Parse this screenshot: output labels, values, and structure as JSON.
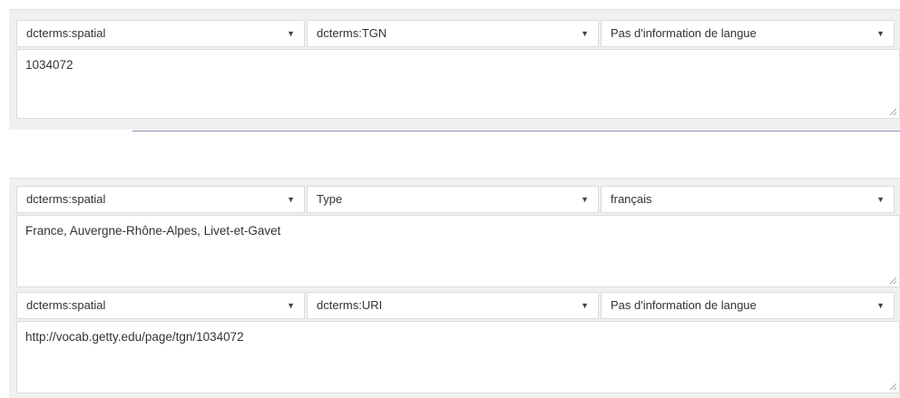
{
  "entries": [
    {
      "property": "dcterms:spatial",
      "type": "dcterms:TGN",
      "language": "Pas d'information de langue",
      "value": "1034072"
    },
    {
      "property": "dcterms:spatial",
      "type": "Type",
      "language": "français",
      "value": "France, Auvergne-Rhône-Alpes, Livet-et-Gavet"
    },
    {
      "property": "dcterms:spatial",
      "type": "dcterms:URI",
      "language": "Pas d'information de langue",
      "value": "http://vocab.getty.edu/page/tgn/1034072"
    }
  ],
  "icons": {
    "dropdown": "caret-down-icon",
    "resize": "resize-grip-icon"
  },
  "colors": {
    "panel_background": "#f0f0f0",
    "field_border": "#dcdcdc",
    "underline_accent": "#8a8fb0"
  }
}
